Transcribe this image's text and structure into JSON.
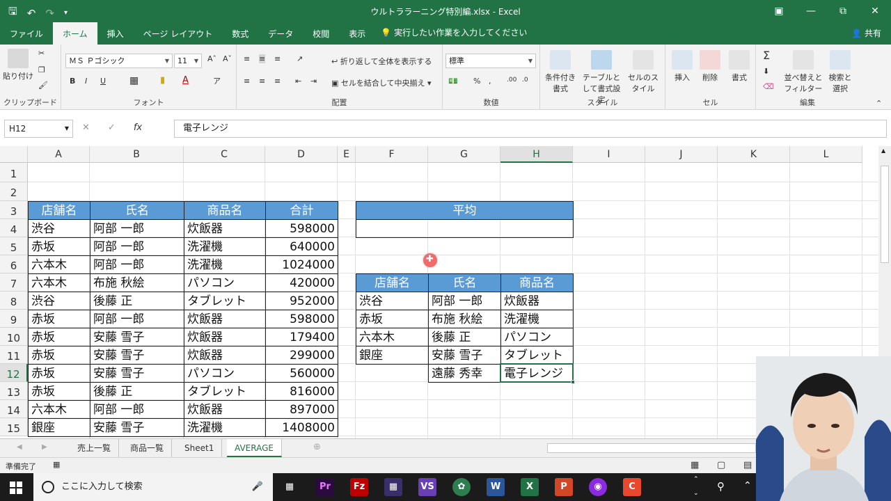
{
  "titlebar": {
    "title": "ウルトララーニング特別編.xlsx  -  Excel",
    "qat": [
      "save-icon",
      "undo-icon",
      "redo-icon",
      "customize-icon"
    ],
    "window_buttons": [
      "ribbon-display-icon",
      "minimize-icon",
      "restore-icon",
      "close-icon"
    ]
  },
  "ribbon_tabs": [
    "ファイル",
    "ホーム",
    "挿入",
    "ページ レイアウト",
    "数式",
    "データ",
    "校閲",
    "表示"
  ],
  "active_tab": "ホーム",
  "tell_me": "実行したい作業を入力してください",
  "share": "共有",
  "ribbon": {
    "clipboard": {
      "paste": "貼り付け",
      "label": "クリップボード"
    },
    "font": {
      "name": "ＭＳ Ｐゴシック",
      "size": "11",
      "label": "フォント"
    },
    "alignment": {
      "wrap": "折り返して全体を表示する",
      "merge": "セルを結合して中央揃え",
      "label": "配置"
    },
    "number": {
      "format": "標準",
      "label": "数値"
    },
    "styles": {
      "cond": "条件付き書式",
      "table": "テーブルとして書式設定",
      "cell": "セルのスタイル",
      "label": "スタイル"
    },
    "cells": {
      "insert": "挿入",
      "delete": "削除",
      "format": "書式",
      "label": "セル"
    },
    "editing": {
      "sort": "並べ替えとフィルター",
      "find": "検索と選択",
      "label": "編集"
    }
  },
  "formula_bar": {
    "name_box": "H12",
    "formula": "電子レンジ"
  },
  "columns": [
    "A",
    "B",
    "C",
    "D",
    "E",
    "F",
    "G",
    "H",
    "I",
    "J",
    "K",
    "L"
  ],
  "rows": [
    "1",
    "2",
    "3",
    "4",
    "5",
    "6",
    "7",
    "8",
    "9",
    "10",
    "11",
    "12",
    "13",
    "14",
    "15"
  ],
  "selected_cell": {
    "column": "H",
    "row": "12"
  },
  "sales_table": {
    "headers": [
      "店舗名",
      "氏名",
      "商品名",
      "合計"
    ],
    "rows": [
      [
        "渋谷",
        "阿部 一郎",
        "炊飯器",
        "598000"
      ],
      [
        "赤坂",
        "阿部 一郎",
        "洗濯機",
        "640000"
      ],
      [
        "六本木",
        "阿部 一郎",
        "洗濯機",
        "1024000"
      ],
      [
        "六本木",
        "布施 秋絵",
        "パソコン",
        "420000"
      ],
      [
        "渋谷",
        "後藤 正",
        "タブレット",
        "952000"
      ],
      [
        "赤坂",
        "阿部 一郎",
        "炊飯器",
        "598000"
      ],
      [
        "赤坂",
        "安藤 雪子",
        "炊飯器",
        "179400"
      ],
      [
        "赤坂",
        "安藤 雪子",
        "炊飯器",
        "299000"
      ],
      [
        "赤坂",
        "安藤 雪子",
        "パソコン",
        "560000"
      ],
      [
        "赤坂",
        "後藤 正",
        "タブレット",
        "816000"
      ],
      [
        "六本木",
        "阿部 一郎",
        "炊飯器",
        "897000"
      ],
      [
        "銀座",
        "安藤 雪子",
        "洗濯機",
        "1408000"
      ]
    ]
  },
  "average_box": {
    "header": "平均",
    "value": ""
  },
  "criteria_table": {
    "headers": [
      "店舗名",
      "氏名",
      "商品名"
    ],
    "rows": [
      [
        "渋谷",
        "阿部 一郎",
        "炊飯器"
      ],
      [
        "赤坂",
        "布施 秋絵",
        "洗濯機"
      ],
      [
        "六本木",
        "後藤 正",
        "パソコン"
      ],
      [
        "銀座",
        "安藤 雪子",
        "タブレット"
      ],
      [
        "",
        "遠藤 秀幸",
        "電子レンジ"
      ]
    ]
  },
  "sheet_tabs": [
    "売上一覧",
    "商品一覧",
    "Sheet1",
    "AVERAGE"
  ],
  "active_sheet": "AVERAGE",
  "status": {
    "ready": "準備完了"
  },
  "taskbar": {
    "search_placeholder": "ここに入力して検索"
  },
  "colors": {
    "excel_green": "#217346",
    "header_blue": "#5b9bd5"
  }
}
